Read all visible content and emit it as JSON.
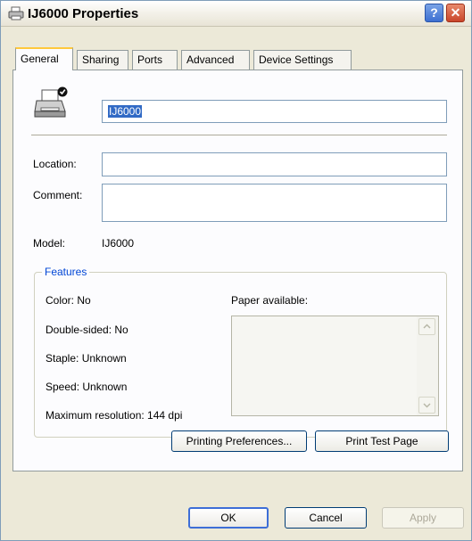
{
  "window": {
    "title": "IJ6000 Properties",
    "help_glyph": "?",
    "close_glyph": "✕"
  },
  "tabs": [
    {
      "label": "General",
      "active": true
    },
    {
      "label": "Sharing",
      "active": false
    },
    {
      "label": "Ports",
      "active": false
    },
    {
      "label": "Advanced",
      "active": false
    },
    {
      "label": "Device Settings",
      "active": false
    }
  ],
  "general": {
    "printer_name": "IJ6000",
    "location_label": "Location:",
    "location_value": "",
    "comment_label": "Comment:",
    "comment_value": "",
    "model_label": "Model:",
    "model_value": "IJ6000"
  },
  "features": {
    "title": "Features",
    "color": "Color: No",
    "double_sided": "Double-sided: No",
    "staple": "Staple: Unknown",
    "speed": "Speed: Unknown",
    "max_resolution": "Maximum resolution: 144 dpi",
    "paper_available_label": "Paper available:",
    "paper_list": []
  },
  "buttons": {
    "printing_preferences": "Printing Preferences...",
    "print_test_page": "Print Test Page",
    "ok": "OK",
    "cancel": "Cancel",
    "apply": "Apply"
  },
  "icons": {
    "title_icon": "printer-small-icon",
    "printer_icon": "printer-default-icon",
    "scroll_up": "scroll-up-arrow-icon",
    "scroll_down": "scroll-down-arrow-icon"
  },
  "colors": {
    "accent": "#316ac5",
    "tab_highlight": "#ffc83c",
    "groupbox_title": "#0046d5"
  }
}
